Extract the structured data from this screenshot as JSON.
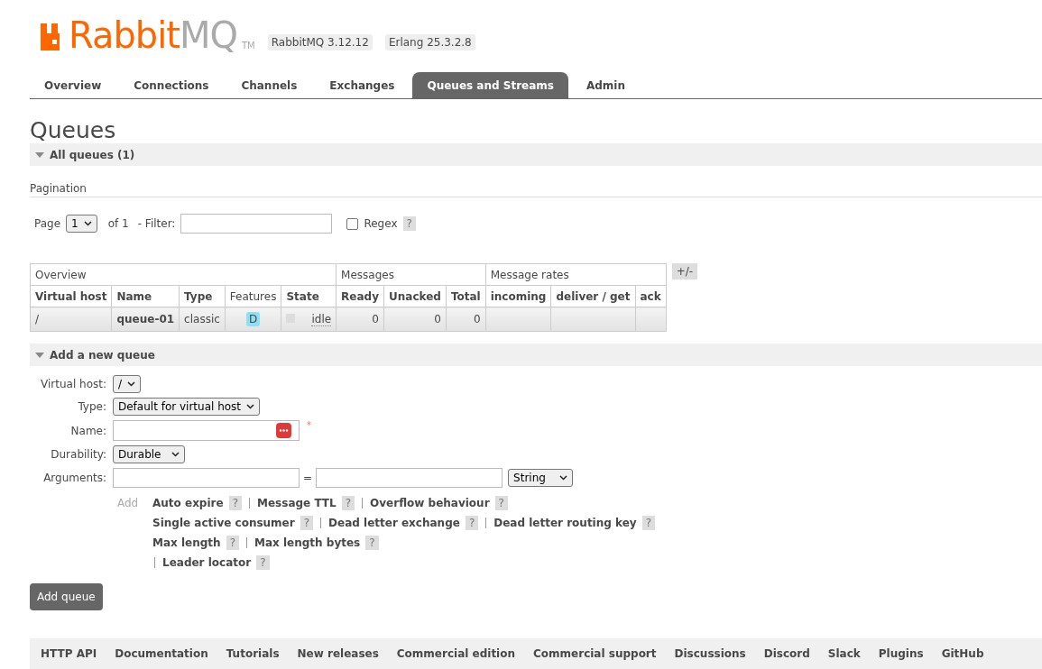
{
  "header": {
    "logo": {
      "brand": "Rabbit",
      "brand_suffix": "MQ",
      "tm": "TM"
    },
    "versions": [
      "RabbitMQ 3.12.12",
      "Erlang 25.3.2.8"
    ]
  },
  "tabs": [
    {
      "label": "Overview",
      "selected": false
    },
    {
      "label": "Connections",
      "selected": false
    },
    {
      "label": "Channels",
      "selected": false
    },
    {
      "label": "Exchanges",
      "selected": false
    },
    {
      "label": "Queues and Streams",
      "selected": true
    },
    {
      "label": "Admin",
      "selected": false
    }
  ],
  "page_title": "Queues",
  "all_queues": {
    "title": "All queues (1)",
    "expanded": true
  },
  "pagination": {
    "heading": "Pagination",
    "page_label": "Page",
    "page_value": "1",
    "of_label": "of 1",
    "filter_label": "- Filter:",
    "regex_label": "Regex",
    "regex_checked": false,
    "help": "?"
  },
  "table": {
    "groups": [
      "Overview",
      "Messages",
      "Message rates"
    ],
    "toggle": "+/-",
    "columns": [
      "Virtual host",
      "Name",
      "Type",
      "Features",
      "State",
      "Ready",
      "Unacked",
      "Total",
      "incoming",
      "deliver / get",
      "ack"
    ],
    "rows": [
      {
        "virtual_host": "/",
        "name": "queue-01",
        "type": "classic",
        "feature": "D",
        "state": "idle",
        "ready": "0",
        "unacked": "0",
        "total": "0"
      }
    ]
  },
  "add_queue": {
    "title": "Add a new queue",
    "expanded": true,
    "virtual_host_label": "Virtual host:",
    "virtual_host_value": "/",
    "type_label": "Type:",
    "type_value": "Default for virtual host",
    "name_label": "Name:",
    "required_mark": "*",
    "durability_label": "Durability:",
    "durability_value": "Durable",
    "arguments_label": "Arguments:",
    "equals": "=",
    "argument_type": "String",
    "add_label": "Add",
    "argument_rows": [
      [
        {
          "label": "Auto expire",
          "help": "?",
          "divider_before": false
        },
        {
          "label": "Message TTL",
          "help": "?",
          "divider_before": true
        },
        {
          "label": "Overflow behaviour",
          "help": "?",
          "divider_before": true
        }
      ],
      [
        {
          "label": "Single active consumer",
          "help": "?",
          "divider_before": false
        },
        {
          "label": "Dead letter exchange",
          "help": "?",
          "divider_before": true
        },
        {
          "label": "Dead letter routing key",
          "help": "?",
          "divider_before": true
        }
      ],
      [
        {
          "label": "Max length",
          "help": "?",
          "divider_before": false
        },
        {
          "label": "Max length bytes",
          "help": "?",
          "divider_before": true
        }
      ],
      [
        {
          "label": "Leader locator",
          "help": "?",
          "divider_before": true
        }
      ]
    ],
    "submit": "Add queue"
  },
  "footer_links": [
    "HTTP API",
    "Documentation",
    "Tutorials",
    "New releases",
    "Commercial edition",
    "Commercial support",
    "Discussions",
    "Discord",
    "Slack",
    "Plugins",
    "GitHub"
  ]
}
